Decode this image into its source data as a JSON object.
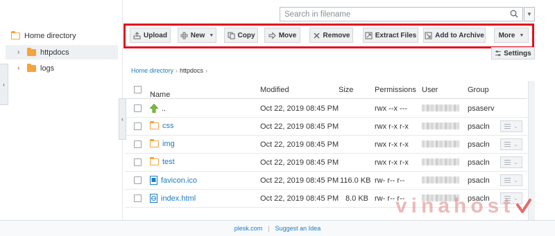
{
  "search": {
    "placeholder": "Search in filename"
  },
  "sidebar": {
    "root_label": "Home directory",
    "items": [
      {
        "label": "httpdocs",
        "selected": true
      },
      {
        "label": "logs",
        "selected": false
      }
    ]
  },
  "toolbar": {
    "upload": "Upload",
    "new": "New",
    "copy": "Copy",
    "move": "Move",
    "remove": "Remove",
    "extract": "Extract Files",
    "archive": "Add to Archive",
    "more": "More",
    "highlight_color": "#e30e1b"
  },
  "settings_label": "Settings",
  "breadcrumb": {
    "home": "Home directory",
    "current": "httpdocs"
  },
  "table": {
    "headers": {
      "name": "Name",
      "modified": "Modified",
      "size": "Size",
      "permissions": "Permissions",
      "user": "User",
      "group": "Group"
    },
    "rows": [
      {
        "icon": "up-arrow-icon",
        "name": "..",
        "modified": "Oct 22, 2019 08:45 PM",
        "size": "",
        "permissions": "rwx --x ---",
        "group": "psaserv"
      },
      {
        "icon": "folder-icon",
        "name": "css",
        "modified": "Oct 22, 2019 08:45 PM",
        "size": "",
        "permissions": "rwx r-x r-x",
        "group": "psacln"
      },
      {
        "icon": "folder-icon",
        "name": "img",
        "modified": "Oct 22, 2019 08:45 PM",
        "size": "",
        "permissions": "rwx r-x r-x",
        "group": "psacln"
      },
      {
        "icon": "folder-icon",
        "name": "test",
        "modified": "Oct 22, 2019 08:45 PM",
        "size": "",
        "permissions": "rwx r-x r-x",
        "group": "psacln"
      },
      {
        "icon": "file-icon",
        "name": "favicon.ico",
        "modified": "Oct 22, 2019 08:45 PM",
        "size": "116.0 KB",
        "permissions": "rw- r-- r--",
        "group": "psacln"
      },
      {
        "icon": "html-file-icon",
        "name": "index.html",
        "modified": "Oct 22, 2019 08:45 PM",
        "size": "8.0 KB",
        "permissions": "rw- r-- r--",
        "group": "psacln"
      }
    ]
  },
  "footer": {
    "link1": "plesk.com",
    "link2": "Suggest an Idea"
  },
  "watermark": "vinahost",
  "colors": {
    "link": "#1a7cc4",
    "folder": "#f5a33f"
  }
}
